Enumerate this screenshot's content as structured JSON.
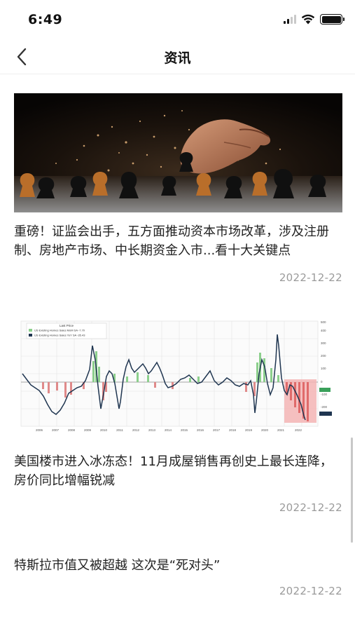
{
  "status_bar": {
    "time": "6:49"
  },
  "nav": {
    "title": "资讯",
    "back_icon": "chevron-left-icon"
  },
  "articles": [
    {
      "title": "重磅！证监会出手，五方面推动资本市场改革，涉及注册制、房地产市场、中长期资金入市...看十大关键点",
      "date": "2022-12-22",
      "image": "chess-hand-photo"
    },
    {
      "title": "美国楼市进入冰冻态！11月成屋销售再创史上最长连降，房价同比增幅锐减",
      "date": "2022-12-22",
      "image": "housing-chart",
      "chart_legend": {
        "heading": "Last Price",
        "lines": [
          "US Existing Homes Sales MoM SA  -7.70",
          "US Existing Homes Sales YoY SA  -35.43"
        ]
      },
      "chart_x_labels": [
        "2006",
        "2007",
        "2008",
        "2009",
        "2010",
        "2011",
        "2012",
        "2013",
        "2014",
        "2015",
        "2016",
        "2017",
        "2018",
        "2019",
        "2020",
        "2021",
        "2022"
      ],
      "chart_y_labels": [
        "500",
        "400",
        "300",
        "200",
        "100",
        "0",
        "-100",
        "-200"
      ]
    },
    {
      "title": "特斯拉市值又被超越 这次是“死对头”",
      "date": "2022-12-22"
    }
  ]
}
